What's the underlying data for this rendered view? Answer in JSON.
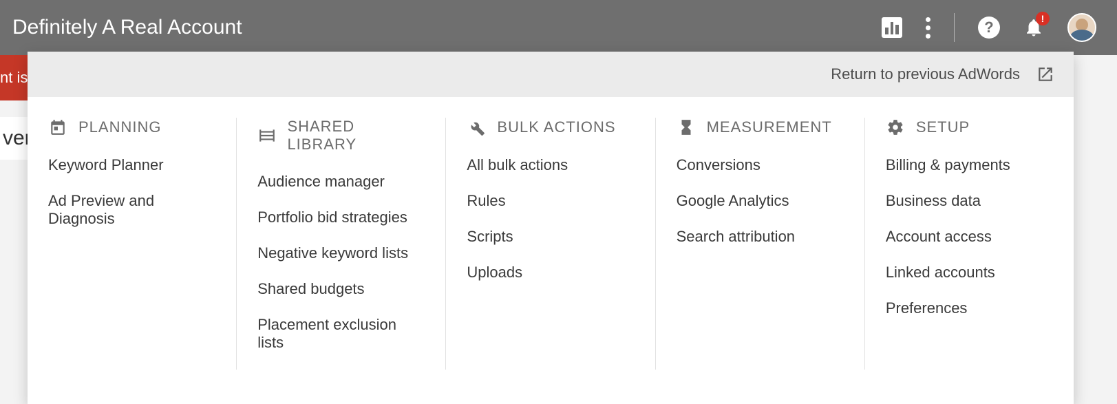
{
  "header": {
    "account_title": "Definitely A Real Account",
    "notification_badge": "!"
  },
  "redbar_fragment": "nt is",
  "behind_fragment": "ver",
  "panel": {
    "return_label": "Return to previous AdWords",
    "columns": [
      {
        "title": "PLANNING",
        "links": [
          "Keyword Planner",
          "Ad Preview and Diagnosis"
        ]
      },
      {
        "title": "SHARED LIBRARY",
        "links": [
          "Audience manager",
          "Portfolio bid strategies",
          "Negative keyword lists",
          "Shared budgets",
          "Placement exclusion lists"
        ]
      },
      {
        "title": "BULK ACTIONS",
        "links": [
          "All bulk actions",
          "Rules",
          "Scripts",
          "Uploads"
        ]
      },
      {
        "title": "MEASUREMENT",
        "links": [
          "Conversions",
          "Google Analytics",
          "Search attribution"
        ]
      },
      {
        "title": "SETUP",
        "links": [
          "Billing & payments",
          "Business data",
          "Account access",
          "Linked accounts",
          "Preferences"
        ]
      }
    ]
  }
}
